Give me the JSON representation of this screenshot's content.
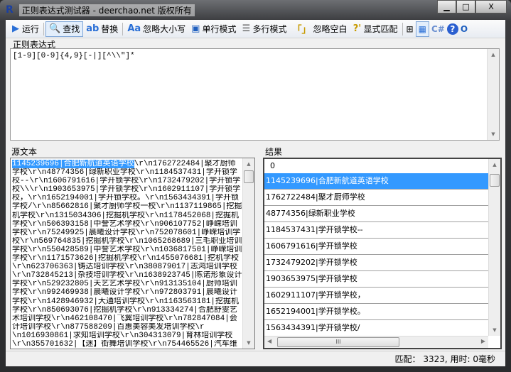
{
  "window": {
    "title": "正则表达式测试器 - deerchao.net 版权所有",
    "logo": "R",
    "min": "▁",
    "max": "□",
    "close": "X"
  },
  "toolbar": [
    {
      "icon": "▶",
      "label": "运行",
      "name": "run"
    },
    {
      "icon": "🔍",
      "label": "查找",
      "name": "find",
      "active": true
    },
    {
      "icon": "ab",
      "label": "替换",
      "name": "replace"
    },
    {
      "icon": "Aa",
      "label": "忽略大小写",
      "name": "ignore-case"
    },
    {
      "icon": "▣",
      "label": "单行模式",
      "name": "single-line"
    },
    {
      "icon": "☰",
      "label": "多行模式",
      "name": "multi-line"
    },
    {
      "icon": "「」",
      "label": "忽略空白",
      "name": "ignore-whitespace"
    },
    {
      "icon": "?'",
      "label": "显式匹配",
      "name": "explicit-capture"
    }
  ],
  "toolbar_icons": [
    "tree-view",
    "table-view",
    "csharp",
    "help",
    "info"
  ],
  "regex": {
    "label": "正则表达式",
    "value": "[1-9][0-9]{4,9}[-|][^\\\\\"]*"
  },
  "source": {
    "label": "源文本",
    "highlight": "1145239696|合肥新航道英语学校",
    "lines": [
      "\\r\\n1762722484|聚才厨师",
      "学校\\r\\n48774356|绿新职业学校\\r\\n1184537431|学开锁学",
      "校--\\r\\n1606791616|学开锁学校\\r\\n1732479202|学开锁学",
      "校\\\\\\r\\n1903653975|学开锁学校\\r\\n1602911107|学开锁学",
      "校，\\r\\n1652194001|学开锁学校。\\r\\n1563434391|学开锁",
      "学校/\\r\\n85662816|聚才厨师学校一校\\r\\n1137119865|挖掘",
      "机学校\\r\\n1315034306|挖掘机学校\\r\\n1178452068|挖掘机",
      "学校\\r\\n506393158|中誉艺术学校\\r\\n906107752|峥嵘培训",
      "学校\\r\\n75249925|晨曦设计学校\\r\\n752078601|峥嵘培训学",
      "校\\r\\n569764835|挖掘机学校\\r\\n1065268689|三毛职业培训",
      "学校\\r\\n550428589|中誉艺术学校\\r\\n1036817501|峥嵘培训",
      "学校\\r\\n1171573626|挖掘机学校\\r\\n1455076681|挖机学校",
      "\\r\\n623706363|铸达培训学校\\r\\n380879017|志鸿培训学校",
      "\\r\\n732845213|杂技培训学校\\r\\n1638923745|陈诺形象设计",
      "学校\\r\\n529232805|天艺艺术学校\\r\\n913135104|厨师培训",
      "学校\\r\\n992469938|晨曦设计学校\\r\\n972803791|晨曦设计",
      "学校\\r\\n1428946932|大通培训学校\\r\\n1163563181|挖掘机",
      "学校\\r\\n850693076|挖掘机学校\\r\\n913334274|合肥舒雯艺",
      "术培训学校\\r\\n462108470|飞翼培训学校\\r\\n782847084|会",
      "计培训学校\\r\\n877588209|百惠美容美发培训学校\\r",
      "\\n1016930861|求知培训学校\\r\\n304313079|育林培训学校",
      "\\r\\n355701632|【迷】街舞培训学校\\r\\n754465526|汽车维"
    ]
  },
  "results": {
    "label": "结果",
    "header": "0",
    "rows": [
      "1145239696|合肥新航道英语学校",
      "1762722484|聚才厨师学校",
      "48774356|绿新职业学校",
      "1184537431|学开锁学校--",
      "1606791616|学开锁学校",
      "1732479202|学开锁学校",
      "1903653975|学开锁学校",
      "1602911107|学开锁学校，",
      "1652194001|学开锁学校。",
      "1563434391|学开锁学校/"
    ],
    "hscroll_mark": "III"
  },
  "status": "匹配： 3323, 用时: 0毫秒"
}
